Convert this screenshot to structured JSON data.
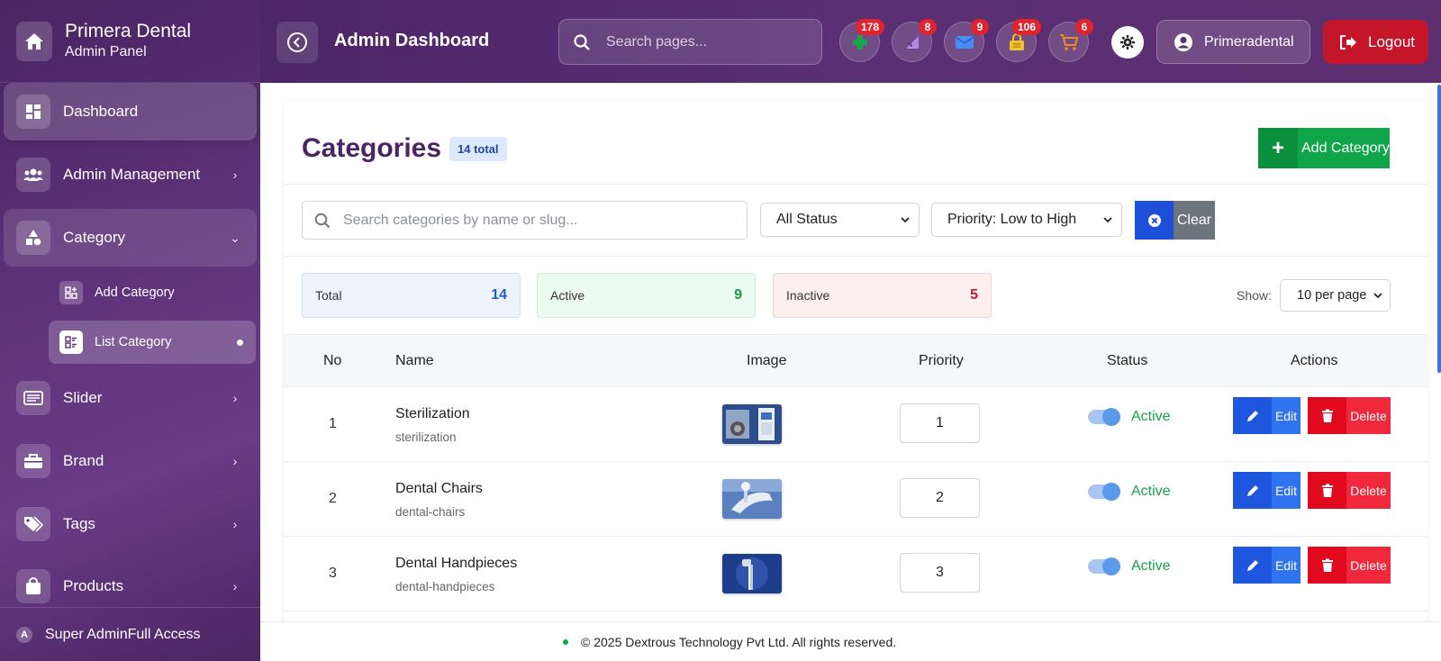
{
  "brand": {
    "title": "Primera Dental",
    "subtitle": "Admin Panel"
  },
  "sidebar": {
    "items": [
      {
        "label": "Dashboard"
      },
      {
        "label": "Admin Management"
      },
      {
        "label": "Category"
      },
      {
        "label": "Slider"
      },
      {
        "label": "Brand"
      },
      {
        "label": "Tags"
      },
      {
        "label": "Products"
      }
    ],
    "sub_items": [
      {
        "label": "Add Category"
      },
      {
        "label": "List Category"
      }
    ],
    "footer": {
      "avatar_letter": "A",
      "label": "Super AdminFull Access"
    }
  },
  "header": {
    "title": "Admin Dashboard",
    "search_placeholder": "Search pages...",
    "notifications": [
      {
        "icon": "medical-plus-icon",
        "count": "178",
        "color": "#19a34a"
      },
      {
        "icon": "feed-icon",
        "count": "8",
        "color": "#b486e8"
      },
      {
        "icon": "mail-icon",
        "count": "9",
        "color": "#4a8cf0"
      },
      {
        "icon": "lock-box-icon",
        "count": "106",
        "color": "#f2c12e"
      },
      {
        "icon": "cart-icon",
        "count": "6",
        "color": "#f28a1e"
      }
    ],
    "user": "Primeradental",
    "logout": "Logout"
  },
  "page": {
    "title": "Categories",
    "total_badge": "14 total",
    "add_button": "Add Category",
    "search_placeholder": "Search categories by name or slug...",
    "status_filter": "All Status",
    "sort_filter": "Priority: Low to High",
    "clear_button": "Clear",
    "stats": [
      {
        "label": "Total",
        "value": "14",
        "bg": "#eef4fd",
        "border": "#cfe0f8",
        "color": "#1d5fd0"
      },
      {
        "label": "Active",
        "value": "9",
        "bg": "#ecfbf0",
        "border": "#c9eed4",
        "color": "#149a3f"
      },
      {
        "label": "Inactive",
        "value": "5",
        "bg": "#fdefef",
        "border": "#f4d2d2",
        "color": "#c8182b"
      }
    ],
    "show_label": "Show:",
    "per_page": "10 per page",
    "columns": [
      "No",
      "Name",
      "Image",
      "Priority",
      "Status",
      "Actions"
    ],
    "rows": [
      {
        "no": "1",
        "name": "Sterilization",
        "slug": "sterilization",
        "priority": "1",
        "status": "Active"
      },
      {
        "no": "2",
        "name": "Dental Chairs",
        "slug": "dental-chairs",
        "priority": "2",
        "status": "Active"
      },
      {
        "no": "3",
        "name": "Dental Handpieces",
        "slug": "dental-handpieces",
        "priority": "3",
        "status": "Active"
      }
    ],
    "edit_label": "Edit",
    "delete_label": "Delete"
  },
  "footer": {
    "text": "© 2025 Dextrous Technology Pvt Ltd. All rights reserved."
  }
}
